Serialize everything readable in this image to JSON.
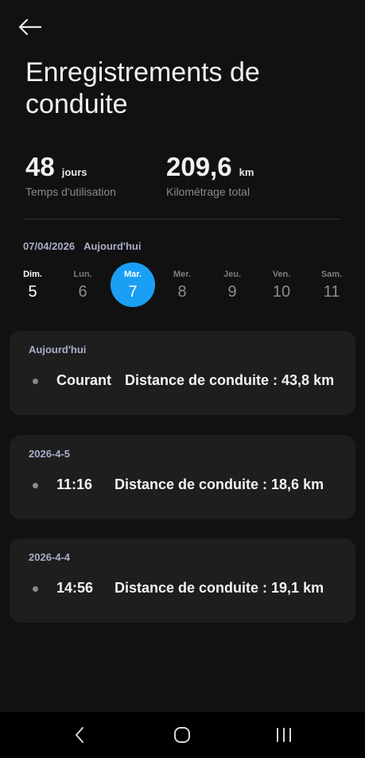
{
  "header": {
    "back_icon": "arrow-left-icon",
    "title": "Enregistrements de conduite"
  },
  "stats": {
    "usage": {
      "value": "48",
      "unit": "jours",
      "label": "Temps d'utilisation"
    },
    "mileage": {
      "value": "209,6",
      "unit": "km",
      "label": "Kilométrage total"
    }
  },
  "date_bar": {
    "date": "07/04/2026",
    "relative": "Aujourd'hui"
  },
  "week": [
    {
      "name": "Dim.",
      "num": "5"
    },
    {
      "name": "Lun.",
      "num": "6"
    },
    {
      "name": "Mar.",
      "num": "7",
      "selected": true
    },
    {
      "name": "Mer.",
      "num": "8"
    },
    {
      "name": "Jeu.",
      "num": "9"
    },
    {
      "name": "Ven.",
      "num": "10"
    },
    {
      "name": "Sam.",
      "num": "11"
    }
  ],
  "records": [
    {
      "date": "Aujourd'hui",
      "time": "Courant",
      "distance": "Distance de conduite : 43,8 km"
    },
    {
      "date": "2026-4-5",
      "time": "11:16",
      "distance": "Distance de conduite : 18,6 km"
    },
    {
      "date": "2026-4-4",
      "time": "14:56",
      "distance": "Distance de conduite : 19,1 km"
    }
  ],
  "navbar": {
    "back_icon": "nav-back-icon",
    "home_icon": "nav-home-icon",
    "recents_icon": "nav-recents-icon"
  },
  "colors": {
    "accent": "#1a9ff5",
    "background": "#111111",
    "card": "#1e1e1e",
    "date_label": "#a9aec9"
  }
}
